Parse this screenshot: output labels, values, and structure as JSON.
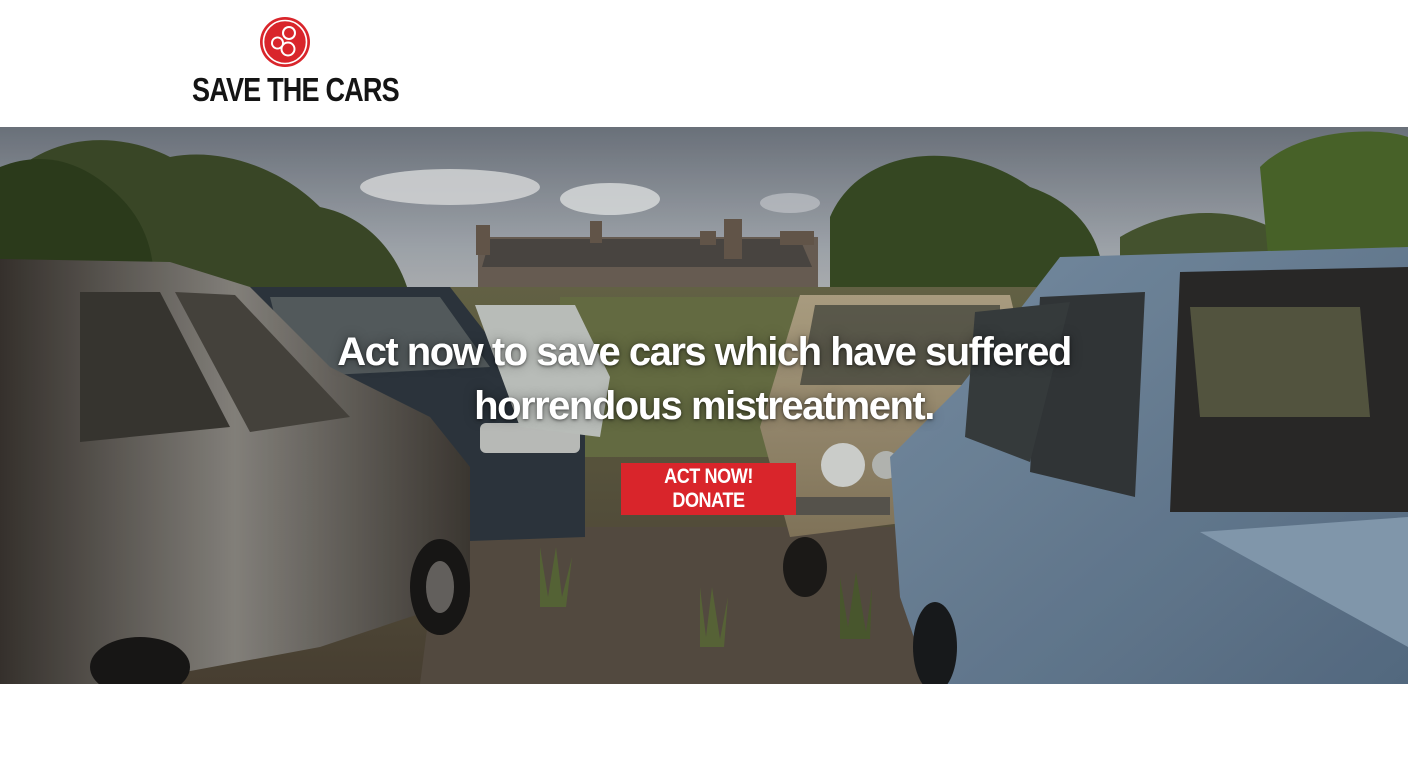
{
  "brand": {
    "name": "SAVE THE CARS",
    "logo_icon": "red-circle-trefoil-icon",
    "accent_color": "#d9252b"
  },
  "hero": {
    "headline": "Act now to save cars which have suffered horrendous mistreatment.",
    "cta_label": "ACT NOW! DONATE",
    "cta_color": "#d9252b",
    "background_image": "abandoned-cars-field-photo"
  }
}
